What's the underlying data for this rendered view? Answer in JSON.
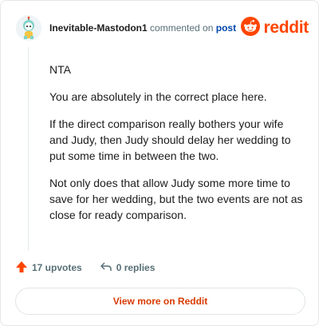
{
  "header": {
    "username": "Inevitable-Mastodon1",
    "commented_text": "commented on",
    "post_link": "post",
    "brand_word": "reddit",
    "avatar_icon": "snoo-avatar-icon",
    "logo_icon": "reddit-alien-logo-icon",
    "brand_color": "#ff4500"
  },
  "comment": {
    "paragraphs": [
      "NTA",
      "You are absolutely in the correct place here.",
      "If the direct comparison really bothers your wife and Judy, then Judy should delay her wedding to put some time in between the two.",
      "Not only does that allow Judy some more time to save for her wedding, but the two events are not as close for ready comparison."
    ]
  },
  "actions": {
    "upvotes": "17 upvotes",
    "replies": "0 replies",
    "upvote_icon": "upvote-arrow-icon",
    "reply_icon": "reply-arrow-icon"
  },
  "footer": {
    "view_more": "View more on Reddit"
  }
}
